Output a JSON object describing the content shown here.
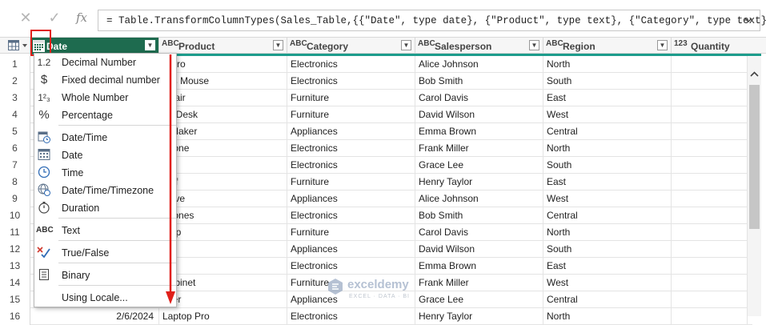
{
  "formula_bar": {
    "cancel_icon": "close-icon",
    "confirm_icon": "check-icon",
    "fx_label": "fx",
    "formula": "= Table.TransformColumnTypes(Sales_Table,{{\"Date\", type date}, {\"Product\", type text}, {\"Category\", type text},"
  },
  "columns": [
    {
      "type_icon": "calendar-icon",
      "label": "Date"
    },
    {
      "type_icon": "ABC",
      "label": "Product"
    },
    {
      "type_icon": "ABC",
      "label": "Category"
    },
    {
      "type_icon": "ABC",
      "label": "Salesperson"
    },
    {
      "type_icon": "ABC",
      "label": "Region"
    },
    {
      "type_icon": "123",
      "label": "Quantity"
    }
  ],
  "rows": [
    {
      "num": "1",
      "product": "p Pro",
      "category": "Electronics",
      "salesperson": "Alice Johnson",
      "region": "North"
    },
    {
      "num": "2",
      "product": "ess Mouse",
      "category": "Electronics",
      "salesperson": "Bob Smith",
      "region": "South"
    },
    {
      "num": "3",
      "product": "Chair",
      "category": "Furniture",
      "salesperson": "Carol Davis",
      "region": "East"
    },
    {
      "num": "4",
      "product": "ng Desk",
      "category": "Furniture",
      "salesperson": "David Wilson",
      "region": "West"
    },
    {
      "num": "5",
      "product": "e Maker",
      "category": "Appliances",
      "salesperson": "Emma Brown",
      "region": "Central"
    },
    {
      "num": "6",
      "product": "phone",
      "category": "Electronics",
      "salesperson": "Frank Miller",
      "region": "North"
    },
    {
      "num": "7",
      "product": "",
      "category": "Electronics",
      "salesperson": "Grace Lee",
      "region": "South"
    },
    {
      "num": "8",
      "product": "helf",
      "category": "Furniture",
      "salesperson": "Henry Taylor",
      "region": "East"
    },
    {
      "num": "9",
      "product": "wave",
      "category": "Appliances",
      "salesperson": "Alice Johnson",
      "region": "West"
    },
    {
      "num": "10",
      "product": "phones",
      "category": "Electronics",
      "salesperson": "Bob Smith",
      "region": "Central"
    },
    {
      "num": "11",
      "product": "amp",
      "category": "Furniture",
      "salesperson": "Carol Davis",
      "region": "North"
    },
    {
      "num": "12",
      "product": "er",
      "category": "Appliances",
      "salesperson": "David Wilson",
      "region": "South"
    },
    {
      "num": "13",
      "product": "or",
      "category": "Electronics",
      "salesperson": "Emma Brown",
      "region": "East"
    },
    {
      "num": "14",
      "product": "Cabinet",
      "category": "Furniture",
      "salesperson": "Frank Miller",
      "region": "West"
    },
    {
      "num": "15",
      "product": "rifier",
      "category": "Appliances",
      "salesperson": "Grace Lee",
      "region": "Central"
    },
    {
      "num": "16",
      "date": "2/6/2024",
      "product": "Laptop Pro",
      "category": "Electronics",
      "salesperson": "Henry Taylor",
      "region": "North"
    }
  ],
  "type_menu": {
    "items": [
      {
        "icon": "1.2",
        "label": "Decimal Number"
      },
      {
        "icon": "$",
        "label": "Fixed decimal number"
      },
      {
        "icon": "1²₃",
        "label": "Whole Number"
      },
      {
        "icon": "%",
        "label": "Percentage"
      },
      {
        "icon": "datetime-icon",
        "label": "Date/Time"
      },
      {
        "icon": "calendar-icon",
        "label": "Date"
      },
      {
        "icon": "clock-icon",
        "label": "Time"
      },
      {
        "icon": "globe-clock-icon",
        "label": "Date/Time/Timezone"
      },
      {
        "icon": "stopwatch-icon",
        "label": "Duration"
      },
      {
        "icon": "ABC",
        "label": "Text"
      },
      {
        "icon": "x-check-icon",
        "label": "True/False"
      },
      {
        "icon": "binary-icon",
        "label": "Binary"
      },
      {
        "label": "Using Locale..."
      }
    ]
  },
  "watermark": {
    "name": "exceldemy",
    "tagline": "EXCEL · DATA · BI"
  },
  "colors": {
    "active_header": "#1e6b4f",
    "accent_line": "#1d9c8c",
    "highlight": "#e0201a"
  }
}
